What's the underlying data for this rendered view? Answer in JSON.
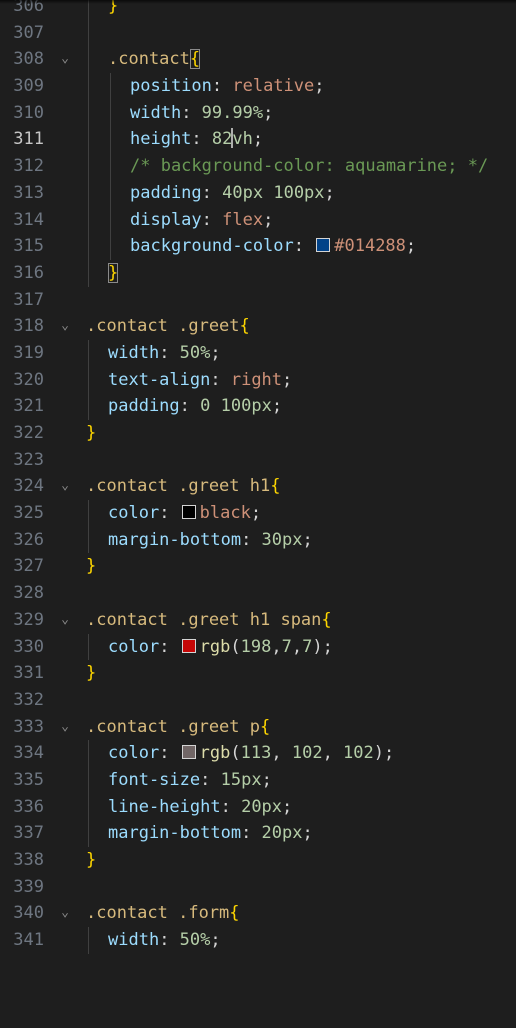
{
  "colors": {
    "background": "#1e1e1e",
    "selector": "#d7ba7d",
    "property": "#9cdcfe",
    "value": "#ce9178",
    "number": "#b5cea8",
    "comment": "#6a9955",
    "brace": "#ffd700"
  },
  "editor": {
    "active_line": "311",
    "lines": [
      {
        "num": "306",
        "fold": "",
        "indent": 1,
        "tokens": [
          {
            "t": "}",
            "c": "brace"
          }
        ]
      },
      {
        "num": "307",
        "fold": "",
        "indent": 1,
        "tokens": []
      },
      {
        "num": "308",
        "fold": "⌄",
        "indent": 1,
        "tokens": [
          {
            "t": ".contact",
            "c": "selector"
          },
          {
            "t": "{",
            "c": "brace match"
          }
        ]
      },
      {
        "num": "309",
        "fold": "",
        "indent": 2,
        "tokens": [
          {
            "t": "position",
            "c": "prop"
          },
          {
            "t": ": ",
            "c": "punct"
          },
          {
            "t": "relative",
            "c": "value"
          },
          {
            "t": ";",
            "c": "punct"
          }
        ]
      },
      {
        "num": "310",
        "fold": "",
        "indent": 2,
        "tokens": [
          {
            "t": "width",
            "c": "prop"
          },
          {
            "t": ": ",
            "c": "punct"
          },
          {
            "t": "99.99%",
            "c": "num"
          },
          {
            "t": ";",
            "c": "punct"
          }
        ]
      },
      {
        "num": "311",
        "fold": "",
        "indent": 2,
        "tokens": [
          {
            "t": "height",
            "c": "prop"
          },
          {
            "t": ": ",
            "c": "punct"
          },
          {
            "t": "82",
            "c": "num"
          },
          {
            "cursor": true
          },
          {
            "t": "vh",
            "c": "num"
          },
          {
            "t": ";",
            "c": "punct"
          }
        ]
      },
      {
        "num": "312",
        "fold": "",
        "indent": 2,
        "tokens": [
          {
            "t": "/* background-color: aquamarine; */",
            "c": "comment"
          }
        ]
      },
      {
        "num": "313",
        "fold": "",
        "indent": 2,
        "tokens": [
          {
            "t": "padding",
            "c": "prop"
          },
          {
            "t": ": ",
            "c": "punct"
          },
          {
            "t": "40px",
            "c": "num"
          },
          {
            "t": " ",
            "c": "punct"
          },
          {
            "t": "100px",
            "c": "num"
          },
          {
            "t": ";",
            "c": "punct"
          }
        ]
      },
      {
        "num": "314",
        "fold": "",
        "indent": 2,
        "tokens": [
          {
            "t": "display",
            "c": "prop"
          },
          {
            "t": ": ",
            "c": "punct"
          },
          {
            "t": "flex",
            "c": "value"
          },
          {
            "t": ";",
            "c": "punct"
          }
        ]
      },
      {
        "num": "315",
        "fold": "",
        "indent": 2,
        "tokens": [
          {
            "t": "background-color",
            "c": "prop"
          },
          {
            "t": ": ",
            "c": "punct"
          },
          {
            "swatch": "#014288"
          },
          {
            "t": "#014288",
            "c": "value"
          },
          {
            "t": ";",
            "c": "punct"
          }
        ]
      },
      {
        "num": "316",
        "fold": "",
        "indent": 1,
        "tokens": [
          {
            "t": "}",
            "c": "brace match"
          }
        ]
      },
      {
        "num": "317",
        "fold": "",
        "indent": 0,
        "tokens": []
      },
      {
        "num": "318",
        "fold": "⌄",
        "indent": 0,
        "tokens": [
          {
            "t": ".contact .greet",
            "c": "selector"
          },
          {
            "t": "{",
            "c": "brace"
          }
        ]
      },
      {
        "num": "319",
        "fold": "",
        "indent": 1,
        "tokens": [
          {
            "t": "width",
            "c": "prop"
          },
          {
            "t": ": ",
            "c": "punct"
          },
          {
            "t": "50%",
            "c": "num"
          },
          {
            "t": ";",
            "c": "punct"
          }
        ]
      },
      {
        "num": "320",
        "fold": "",
        "indent": 1,
        "tokens": [
          {
            "t": "text-align",
            "c": "prop"
          },
          {
            "t": ": ",
            "c": "punct"
          },
          {
            "t": "right",
            "c": "value"
          },
          {
            "t": ";",
            "c": "punct"
          }
        ]
      },
      {
        "num": "321",
        "fold": "",
        "indent": 1,
        "tokens": [
          {
            "t": "padding",
            "c": "prop"
          },
          {
            "t": ": ",
            "c": "punct"
          },
          {
            "t": "0",
            "c": "num"
          },
          {
            "t": " ",
            "c": "punct"
          },
          {
            "t": "100px",
            "c": "num"
          },
          {
            "t": ";",
            "c": "punct"
          }
        ]
      },
      {
        "num": "322",
        "fold": "",
        "indent": 0,
        "tokens": [
          {
            "t": "}",
            "c": "brace"
          }
        ]
      },
      {
        "num": "323",
        "fold": "",
        "indent": 0,
        "tokens": []
      },
      {
        "num": "324",
        "fold": "⌄",
        "indent": 0,
        "tokens": [
          {
            "t": ".contact .greet h1",
            "c": "selector"
          },
          {
            "t": "{",
            "c": "brace"
          }
        ]
      },
      {
        "num": "325",
        "fold": "",
        "indent": 1,
        "tokens": [
          {
            "t": "color",
            "c": "prop"
          },
          {
            "t": ": ",
            "c": "punct"
          },
          {
            "swatch": "#000000"
          },
          {
            "t": "black",
            "c": "value"
          },
          {
            "t": ";",
            "c": "punct"
          }
        ]
      },
      {
        "num": "326",
        "fold": "",
        "indent": 1,
        "tokens": [
          {
            "t": "margin-bottom",
            "c": "prop"
          },
          {
            "t": ": ",
            "c": "punct"
          },
          {
            "t": "30px",
            "c": "num"
          },
          {
            "t": ";",
            "c": "punct"
          }
        ]
      },
      {
        "num": "327",
        "fold": "",
        "indent": 0,
        "tokens": [
          {
            "t": "}",
            "c": "brace"
          }
        ]
      },
      {
        "num": "328",
        "fold": "",
        "indent": 0,
        "tokens": []
      },
      {
        "num": "329",
        "fold": "⌄",
        "indent": 0,
        "tokens": [
          {
            "t": ".contact .greet h1 span",
            "c": "selector"
          },
          {
            "t": "{",
            "c": "brace"
          }
        ]
      },
      {
        "num": "330",
        "fold": "",
        "indent": 1,
        "tokens": [
          {
            "t": "color",
            "c": "prop"
          },
          {
            "t": ": ",
            "c": "punct"
          },
          {
            "swatch": "#c60707"
          },
          {
            "t": "rgb",
            "c": "func"
          },
          {
            "t": "(",
            "c": "punct"
          },
          {
            "t": "198",
            "c": "num"
          },
          {
            "t": ",",
            "c": "punct"
          },
          {
            "t": "7",
            "c": "num"
          },
          {
            "t": ",",
            "c": "punct"
          },
          {
            "t": "7",
            "c": "num"
          },
          {
            "t": ");",
            "c": "punct"
          }
        ]
      },
      {
        "num": "331",
        "fold": "",
        "indent": 0,
        "tokens": [
          {
            "t": "}",
            "c": "brace"
          }
        ]
      },
      {
        "num": "332",
        "fold": "",
        "indent": 0,
        "tokens": []
      },
      {
        "num": "333",
        "fold": "⌄",
        "indent": 0,
        "tokens": [
          {
            "t": ".contact .greet p",
            "c": "selector"
          },
          {
            "t": "{",
            "c": "brace"
          }
        ]
      },
      {
        "num": "334",
        "fold": "",
        "indent": 1,
        "tokens": [
          {
            "t": "color",
            "c": "prop"
          },
          {
            "t": ": ",
            "c": "punct"
          },
          {
            "swatch": "#716666"
          },
          {
            "t": "rgb",
            "c": "func"
          },
          {
            "t": "(",
            "c": "punct"
          },
          {
            "t": "113",
            "c": "num"
          },
          {
            "t": ", ",
            "c": "punct"
          },
          {
            "t": "102",
            "c": "num"
          },
          {
            "t": ", ",
            "c": "punct"
          },
          {
            "t": "102",
            "c": "num"
          },
          {
            "t": ");",
            "c": "punct"
          }
        ]
      },
      {
        "num": "335",
        "fold": "",
        "indent": 1,
        "tokens": [
          {
            "t": "font-size",
            "c": "prop"
          },
          {
            "t": ": ",
            "c": "punct"
          },
          {
            "t": "15px",
            "c": "num"
          },
          {
            "t": ";",
            "c": "punct"
          }
        ]
      },
      {
        "num": "336",
        "fold": "",
        "indent": 1,
        "tokens": [
          {
            "t": "line-height",
            "c": "prop"
          },
          {
            "t": ": ",
            "c": "punct"
          },
          {
            "t": "20px",
            "c": "num"
          },
          {
            "t": ";",
            "c": "punct"
          }
        ]
      },
      {
        "num": "337",
        "fold": "",
        "indent": 1,
        "tokens": [
          {
            "t": "margin-bottom",
            "c": "prop"
          },
          {
            "t": ": ",
            "c": "punct"
          },
          {
            "t": "20px",
            "c": "num"
          },
          {
            "t": ";",
            "c": "punct"
          }
        ]
      },
      {
        "num": "338",
        "fold": "",
        "indent": 0,
        "tokens": [
          {
            "t": "}",
            "c": "brace"
          }
        ]
      },
      {
        "num": "339",
        "fold": "",
        "indent": 0,
        "tokens": []
      },
      {
        "num": "340",
        "fold": "⌄",
        "indent": 0,
        "tokens": [
          {
            "t": ".contact .form",
            "c": "selector"
          },
          {
            "t": "{",
            "c": "brace"
          }
        ]
      },
      {
        "num": "341",
        "fold": "",
        "indent": 1,
        "tokens": [
          {
            "t": "width",
            "c": "prop"
          },
          {
            "t": ": ",
            "c": "punct"
          },
          {
            "t": "50%",
            "c": "num"
          },
          {
            "t": ";",
            "c": "punct"
          }
        ]
      }
    ]
  }
}
